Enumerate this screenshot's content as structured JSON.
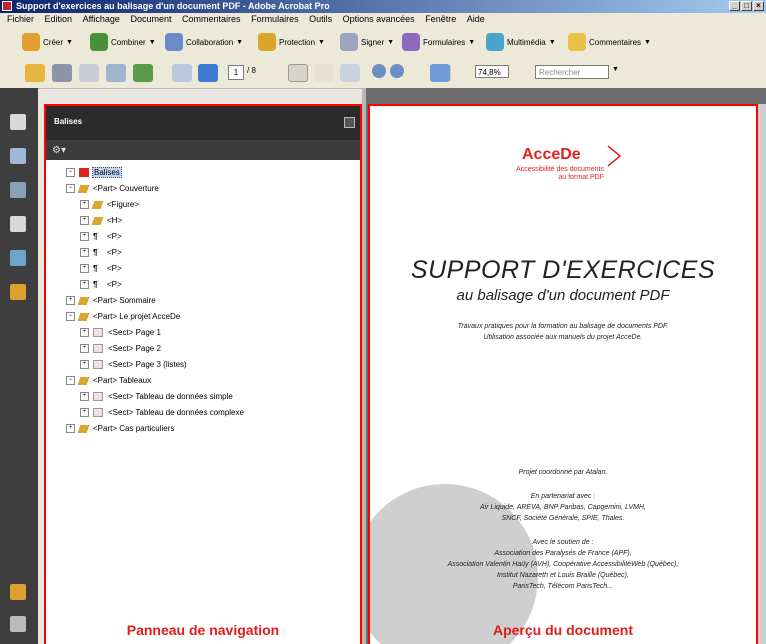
{
  "window": {
    "title": "Support d'exercices au balisage d'un document PDF - Adobe Acrobat Pro"
  },
  "menu": [
    "Fichier",
    "Edition",
    "Affichage",
    "Document",
    "Commentaires",
    "Formulaires",
    "Outils",
    "Options avancées",
    "Fenêtre",
    "Aide"
  ],
  "toolbar": {
    "create": "Créer",
    "combine": "Combiner",
    "collaboration": "Collaboration",
    "protection": "Protection",
    "sign": "Signer",
    "forms": "Formulaires",
    "multimedia": "Multimédia",
    "comments": "Commentaires",
    "page_current": "1",
    "page_total": "/ 8",
    "zoom": "74,8%",
    "search_placeholder": "Rechercher"
  },
  "nav": {
    "title": "Balises",
    "tree": [
      {
        "label": "Balises",
        "level": 0,
        "kind": "root"
      },
      {
        "label": "<Part> Couverture",
        "level": 1,
        "kind": "tag"
      },
      {
        "label": "<Figure>",
        "level": 2,
        "kind": "tag"
      },
      {
        "label": "<H>",
        "level": 2,
        "kind": "tag"
      },
      {
        "label": "<P>",
        "level": 2,
        "kind": "para"
      },
      {
        "label": "<P>",
        "level": 2,
        "kind": "para"
      },
      {
        "label": "<P>",
        "level": 2,
        "kind": "para"
      },
      {
        "label": "<P>",
        "level": 2,
        "kind": "para"
      },
      {
        "label": "<Part> Sommaire",
        "level": 1,
        "kind": "tag"
      },
      {
        "label": "<Part> Le projet AcceDe",
        "level": 1,
        "kind": "tag"
      },
      {
        "label": "<Sect> Page 1",
        "level": 2,
        "kind": "page"
      },
      {
        "label": "<Sect> Page 2",
        "level": 2,
        "kind": "page"
      },
      {
        "label": "<Sect> Page 3 (listes)",
        "level": 2,
        "kind": "page"
      },
      {
        "label": "<Part> Tableaux",
        "level": 1,
        "kind": "tag"
      },
      {
        "label": "<Sect> Tableau de données simple",
        "level": 2,
        "kind": "page"
      },
      {
        "label": "<Sect> Tableau de données complexe",
        "level": 2,
        "kind": "page"
      },
      {
        "label": "<Part> Cas particuliers",
        "level": 1,
        "kind": "tag"
      }
    ],
    "caption": "Panneau de navigation"
  },
  "doc": {
    "logo": "AcceDe",
    "logo_sub1": "Accessibilité des documents",
    "logo_sub2": "au format PDF",
    "heading1": "SUPPORT D'EXERCICES",
    "heading2": "au balisage d'un document PDF",
    "intro1": "Travaux pratiques pour la formation au balisage de documents PDF.",
    "intro2": "Utilisation associée aux manuels du projet AcceDe.",
    "coord": "Projet coordonné par Atalan.",
    "partners_title": "En partenariat avec :",
    "partners1": "Air Liquide, AREVA, BNP Paribas, Capgemini, LVMH,",
    "partners2": "SNCF, Société Générale, SPIE, Thales.",
    "support_title": "Avec le soutien de :",
    "support1": "Association des Paralysés de France (APF),",
    "support2": "Association Valentin Haüy (AVH), Coopérative AccessibilitéWeb (Québec),",
    "support3": "Institut Nazareth et Louis Braille (Québec),",
    "support4": "ParisTech, Télécom ParisTech...",
    "caption": "Aperçu du document"
  },
  "colors": {
    "accent_red": "#e2231a",
    "frame_red": "#ff0000",
    "panel_dark": "#2b2b2b"
  }
}
